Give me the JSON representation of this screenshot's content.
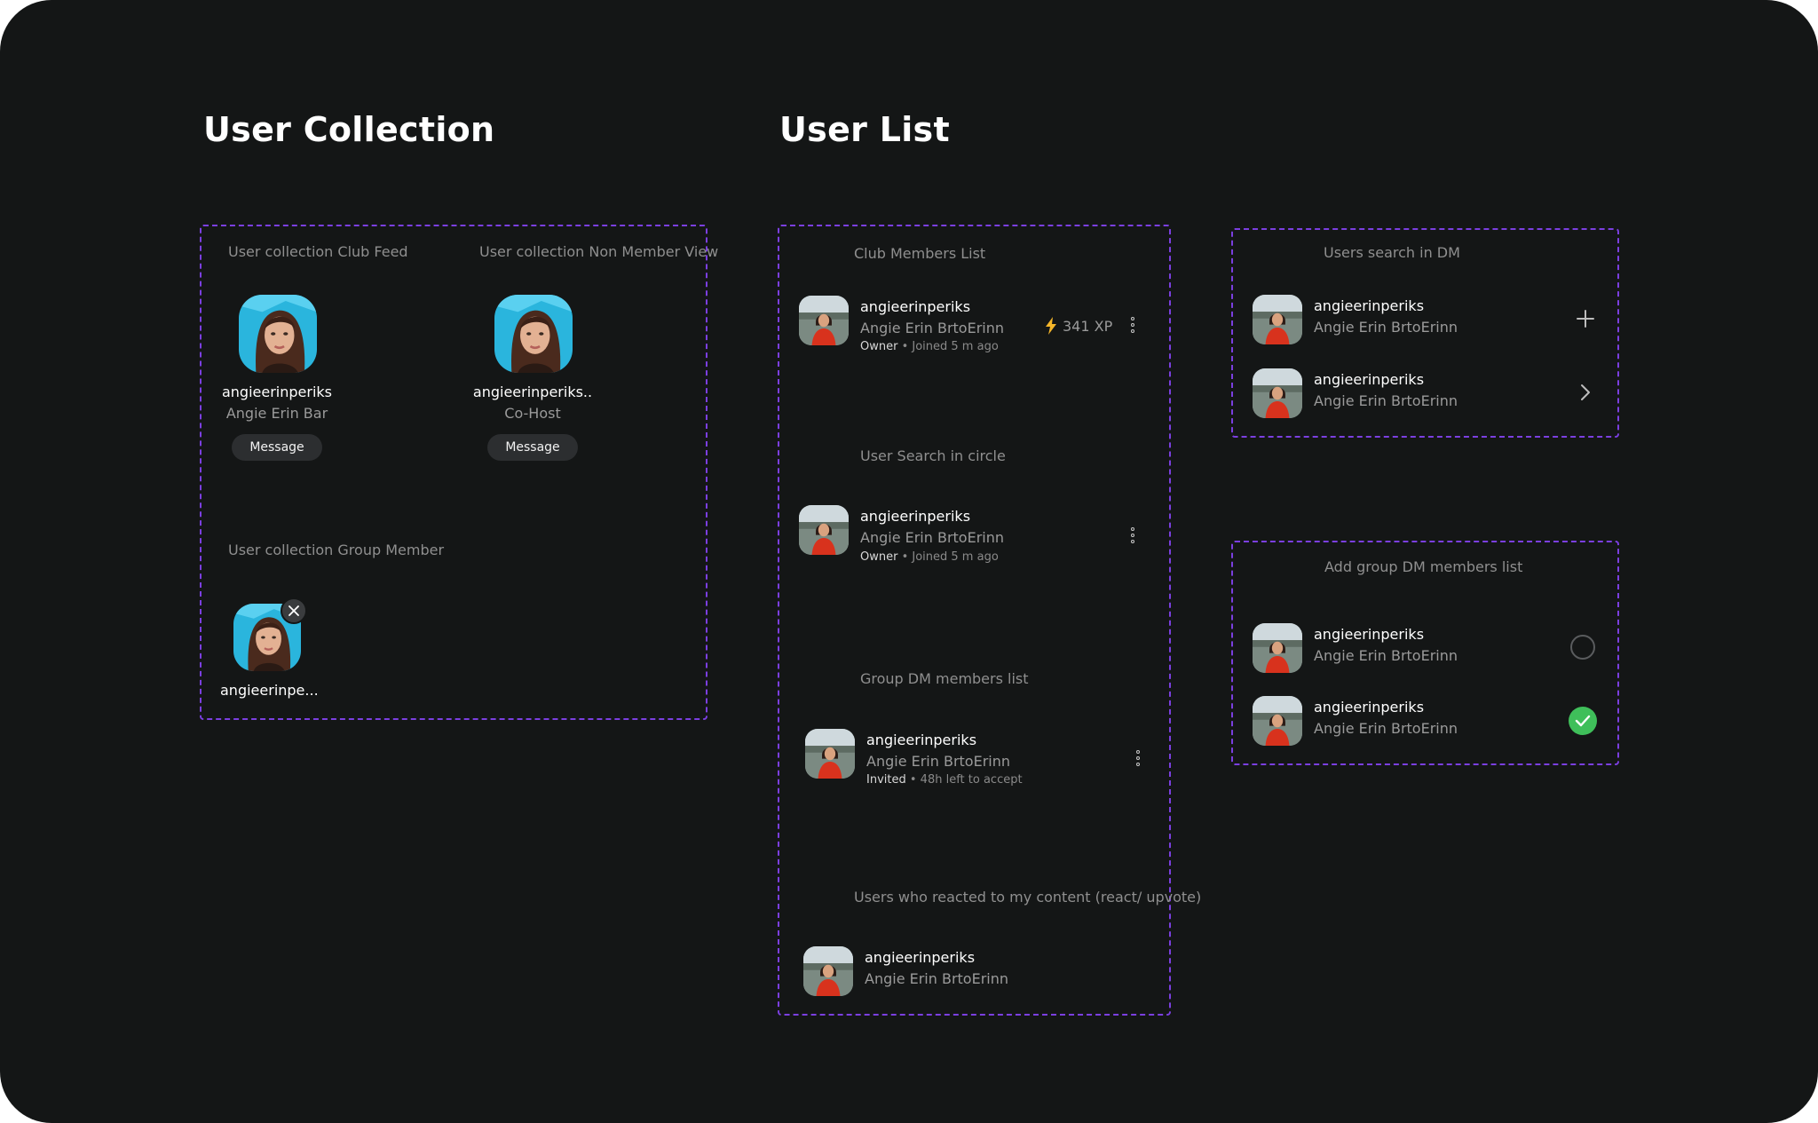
{
  "collection": {
    "heading": "User Collection",
    "club_feed": {
      "caption": "User collection Club Feed",
      "username": "angieerinperiks",
      "display_name": "Angie Erin Bar",
      "button": "Message"
    },
    "non_member": {
      "caption": "User collection Non Member View",
      "username": "angieerinperiks..",
      "role": "Co-Host",
      "button": "Message"
    },
    "group_member": {
      "caption": "User collection Group Member",
      "username": "angieerinpe..."
    }
  },
  "user_list": {
    "heading": "User List",
    "club_members": {
      "caption": "Club Members List",
      "username": "angieerinperiks",
      "display_name": "Angie Erin BrtoErinn",
      "role": "Owner",
      "meta": " • Joined 5 m ago",
      "xp": "341 XP"
    },
    "circle_search": {
      "caption": "User Search in circle",
      "username": "angieerinperiks",
      "display_name": "Angie Erin BrtoErinn",
      "role": "Owner",
      "meta": " • Joined 5 m ago"
    },
    "group_dm": {
      "caption": "Group DM members list",
      "username": "angieerinperiks",
      "display_name": "Angie Erin BrtoErinn",
      "role": "Invited",
      "meta": " • 48h left to accept"
    },
    "reacted": {
      "caption": "Users who reacted to my content (react/ upvote)",
      "username": "angieerinperiks",
      "display_name": "Angie Erin BrtoErinn"
    }
  },
  "dm_search": {
    "caption": "Users search in DM",
    "rows": [
      {
        "username": "angieerinperiks",
        "display_name": "Angie Erin BrtoErinn",
        "action": "plus-icon"
      },
      {
        "username": "angieerinperiks",
        "display_name": "Angie Erin BrtoErinn",
        "action": "chevron-right-icon"
      }
    ]
  },
  "add_group_dm": {
    "caption": "Add group DM members list",
    "rows": [
      {
        "username": "angieerinperiks",
        "display_name": "Angie Erin BrtoErinn",
        "selected": false
      },
      {
        "username": "angieerinperiks",
        "display_name": "Angie Erin BrtoErinn",
        "selected": true
      }
    ]
  },
  "colors": {
    "background": "#141616",
    "panel_border": "#7b3fe0",
    "accent_check": "#3fbf5a",
    "xp_bolt": "#f5b62a"
  }
}
